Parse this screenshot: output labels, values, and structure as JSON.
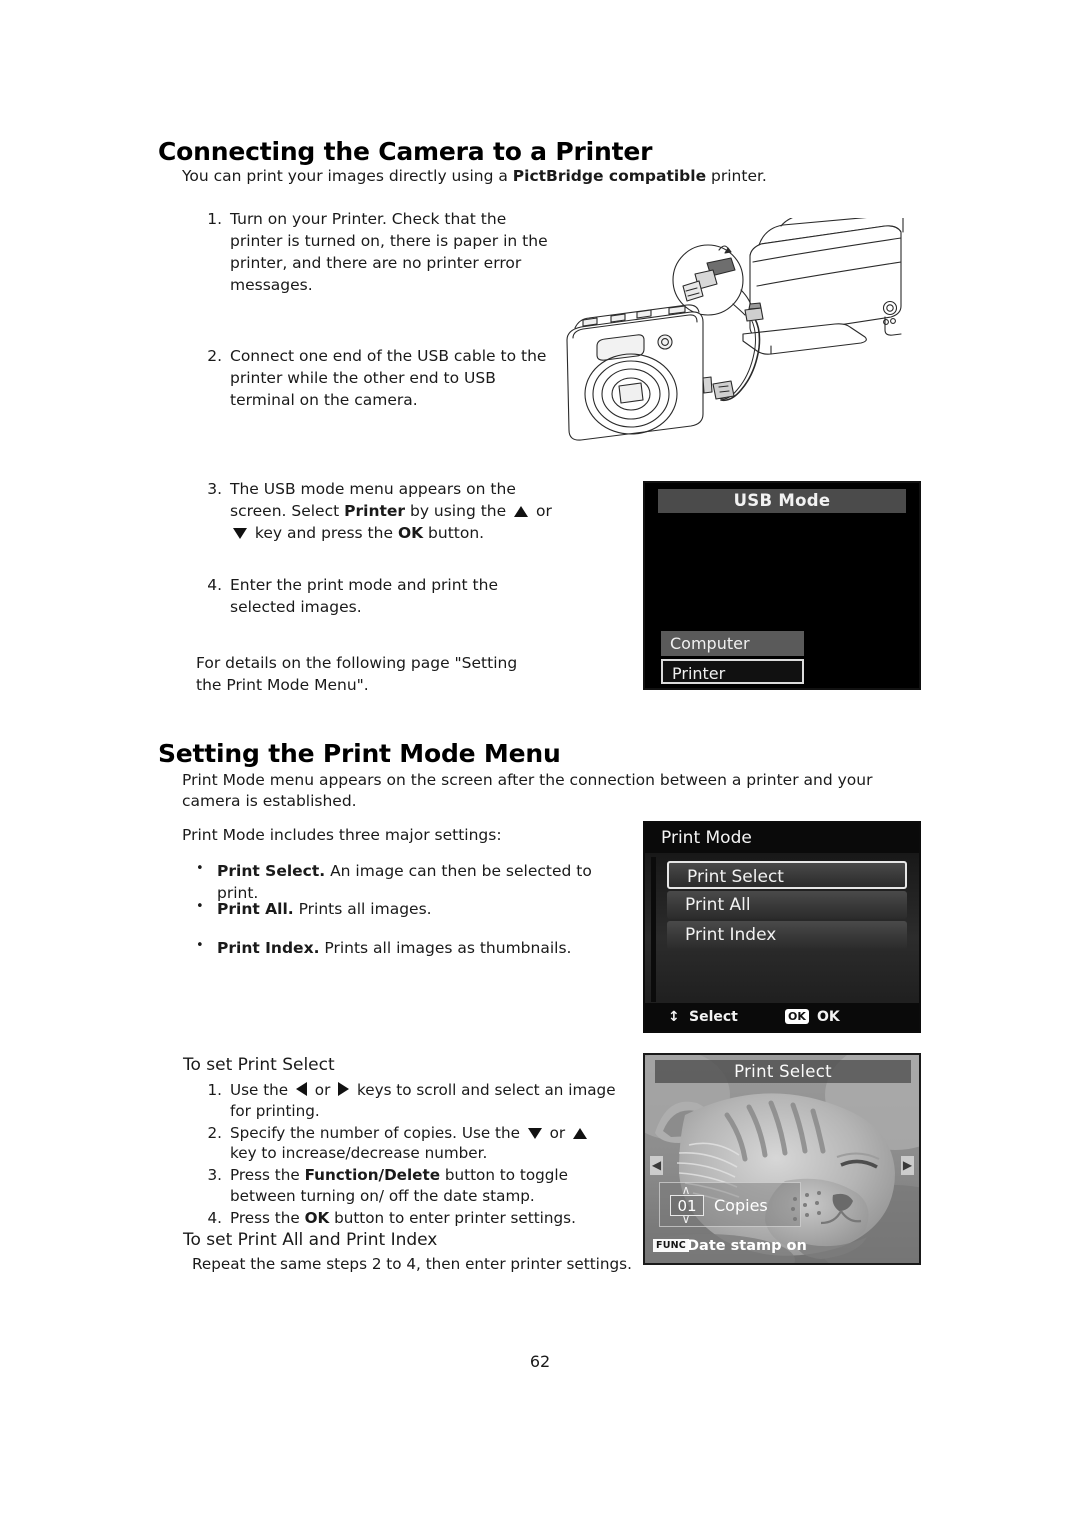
{
  "document": {
    "page_number": "62"
  },
  "sections": {
    "connecting": {
      "title": "Connecting the Camera to a Printer",
      "lead_prefix": "You can print your images directly using a ",
      "lead_bold": "PictBridge compatible",
      "lead_suffix": " printer.",
      "steps": [
        {
          "num": "1.",
          "text": "Turn on your Printer. Check that the printer is turned on, there is paper in the printer, and there are no printer error messages."
        },
        {
          "num": "2.",
          "text": "Connect one end of the USB cable to the printer while the other end to USB terminal on the camera."
        },
        {
          "num": "3.",
          "part_a": "The USB mode menu appears on the screen. Select ",
          "bold_printer": "Printer",
          "part_b": " by using the ",
          "part_c": " or ",
          "part_d": " key and press the ",
          "bold_ok": "OK",
          "part_e": " button."
        },
        {
          "num": "4.",
          "text": "Enter the print mode and print the selected images."
        }
      ],
      "details_note": "For details on the following page \"Setting the Print Mode Menu\"."
    },
    "setting": {
      "title": "Setting the Print Mode Menu",
      "lead": "Print Mode menu appears on the screen after the connection between a printer and your camera is established.",
      "includes_line": "Print Mode includes three major settings:",
      "bullets": [
        {
          "marker": "•",
          "bold": "Print Select.",
          "rest": " An image can then be selected to print."
        },
        {
          "marker": "•",
          "bold": "Print All.",
          "rest": " Prints all images."
        },
        {
          "marker": "•",
          "bold": "Print Index.",
          "rest": " Prints all images as thumbnails."
        }
      ],
      "print_select_heading": "To set Print Select",
      "print_select_steps": [
        {
          "num": "1.",
          "part_a": "Use the ",
          "part_b": " or ",
          "part_c": " keys to scroll and select an image for printing."
        },
        {
          "num": "2.",
          "part_a": "Specify the number of copies. Use the ",
          "part_b": " or ",
          "part_c": " key to increase/decrease number."
        },
        {
          "num": "3.",
          "part_a": "Press the ",
          "bold": "Function/Delete",
          "part_b": " button to toggle between turning on/ off the date stamp."
        },
        {
          "num": "4.",
          "part_a": "Press the ",
          "bold": "OK",
          "part_b": " button to enter printer settings."
        }
      ],
      "print_all_heading": "To set Print All and Print Index",
      "print_all_text": "Repeat the same steps 2 to 4, then enter printer settings."
    }
  },
  "screens": {
    "usb_mode": {
      "title": "USB Mode",
      "options": [
        {
          "label": "Computer",
          "selected": false
        },
        {
          "label": "Printer",
          "selected": true
        }
      ]
    },
    "print_mode": {
      "title": "Print Mode",
      "items": [
        {
          "label": "Print Select",
          "selected": true
        },
        {
          "label": "Print All",
          "selected": false
        },
        {
          "label": "Print Index",
          "selected": false
        }
      ],
      "footer": {
        "updown_glyph": "↕",
        "select_label": "Select",
        "ok_badge": "OK",
        "ok_label": "OK"
      }
    },
    "print_select": {
      "title": "Print Select",
      "arrow_left": "◀",
      "arrow_right": "▶",
      "chevron_up": "∧",
      "chevron_down": "∨",
      "copies_count": "01",
      "copies_label": "Copies",
      "func_badge": "FUNC",
      "date_stamp_label": "Date stamp on",
      "photo_description": "sleeping cat photo (grayscale)"
    }
  },
  "colors": {
    "paper": "#ffffff",
    "ink": "#1a1a1a",
    "lcd_black": "#000000",
    "lcd_titlebar_gray": "#4b4b4b",
    "lcd_highlight_border": "#dcdcdc"
  }
}
